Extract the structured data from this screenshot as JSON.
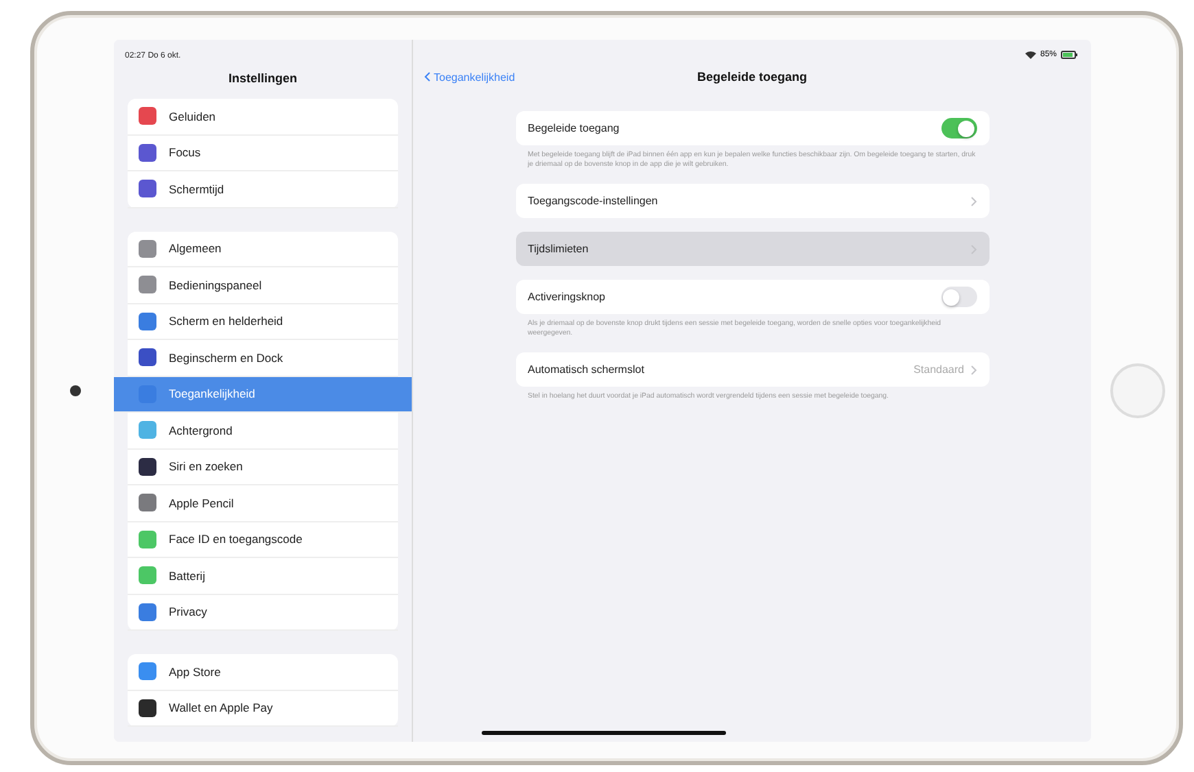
{
  "status_bar": {
    "time": "02:27",
    "date": "Do 6 okt.",
    "battery": "85%"
  },
  "sidebar": {
    "title": "Instellingen",
    "groups": [
      [
        {
          "label": "Geluiden",
          "color": "#e5474f",
          "selected": false
        },
        {
          "label": "Focus",
          "color": "#5b57d0",
          "selected": false
        },
        {
          "label": "Schermtijd",
          "color": "#5b57d0",
          "selected": false
        }
      ],
      [
        {
          "label": "Algemeen",
          "color": "#8e8e93",
          "selected": false
        },
        {
          "label": "Bedieningspaneel",
          "color": "#8e8e93",
          "selected": false
        },
        {
          "label": "Scherm en helderheid",
          "color": "#3a7de0",
          "selected": false
        },
        {
          "label": "Beginscherm en Dock",
          "color": "#3b4fc4",
          "selected": false
        },
        {
          "label": "Toegankelijkheid",
          "color": "#3a7de0",
          "selected": true
        },
        {
          "label": "Achtergrond",
          "color": "#4fb3e3",
          "selected": false
        },
        {
          "label": "Siri en zoeken",
          "color": "#2c2c44",
          "selected": false
        },
        {
          "label": "Apple Pencil",
          "color": "#7a7a7e",
          "selected": false
        },
        {
          "label": "Face ID en toegangscode",
          "color": "#4cc765",
          "selected": false
        },
        {
          "label": "Batterij",
          "color": "#4cc765",
          "selected": false
        },
        {
          "label": "Privacy",
          "color": "#3a7de0",
          "selected": false
        }
      ],
      [
        {
          "label": "App Store",
          "color": "#3a8ef0",
          "selected": false
        },
        {
          "label": "Wallet en Apple Pay",
          "color": "#2b2b2b",
          "selected": false
        }
      ]
    ]
  },
  "detail": {
    "back": "Toegankelijkheid",
    "title": "Begeleide toegang",
    "sections": [
      {
        "rows": [
          {
            "kind": "toggle",
            "label": "Begeleide toegang",
            "on": true,
            "selected": false
          }
        ],
        "footer": "Met begeleide toegang blijft de iPad binnen één app en kun je bepalen welke functies beschikbaar zijn. Om begeleide toegang te starten, druk je driemaal op de bovenste knop in de app die je wilt gebruiken."
      },
      {
        "rows": [
          {
            "kind": "link",
            "label": "Toegangscode-instellingen",
            "selected": false
          }
        ]
      },
      {
        "rows": [
          {
            "kind": "link",
            "label": "Tijdslimieten",
            "selected": true
          }
        ]
      },
      {
        "rows": [
          {
            "kind": "toggle",
            "label": "Activeringsknop",
            "on": false,
            "selected": false
          }
        ],
        "footer": "Als je driemaal op de bovenste knop drukt tijdens een sessie met begeleide toegang, worden de snelle opties voor toegankelijkheid weergegeven."
      },
      {
        "rows": [
          {
            "kind": "link",
            "label": "Automatisch schermslot",
            "value": "Standaard",
            "selected": false
          }
        ],
        "footer": "Stel in hoelang het duurt voordat je iPad automatisch wordt vergrendeld tijdens een sessie met begeleide toegang."
      }
    ]
  }
}
